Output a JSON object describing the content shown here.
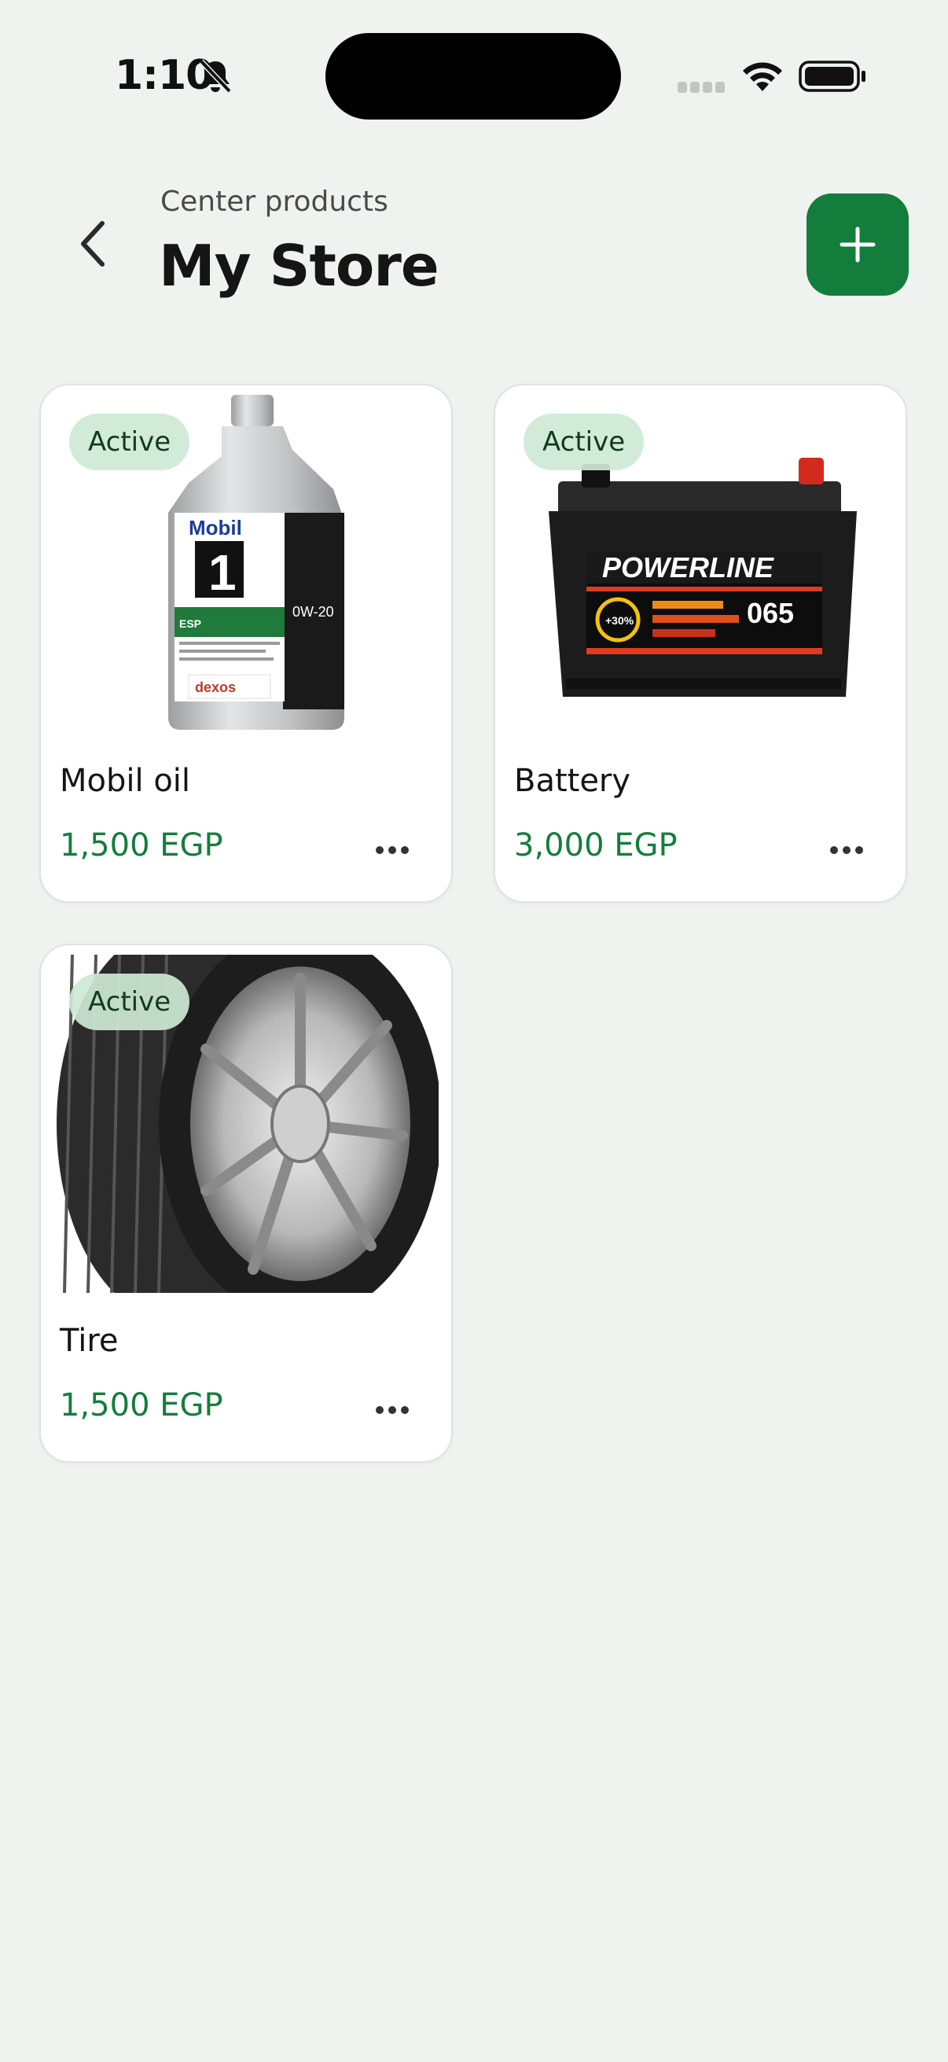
{
  "status_bar": {
    "time": "1:10"
  },
  "header": {
    "subtitle": "Center products",
    "title": "My Store"
  },
  "colors": {
    "accent": "#137e3c",
    "badge_bg": "#cde9d5",
    "background": "#eff3f0"
  },
  "products": [
    {
      "name": "Mobil oil",
      "price": "1,500 EGP",
      "status": "Active",
      "image": "mobil-oil-bottle"
    },
    {
      "name": "Battery",
      "price": "3,000 EGP",
      "status": "Active",
      "image": "car-battery"
    },
    {
      "name": "Tire",
      "price": "1,500 EGP",
      "status": "Active",
      "image": "car-tire"
    }
  ]
}
